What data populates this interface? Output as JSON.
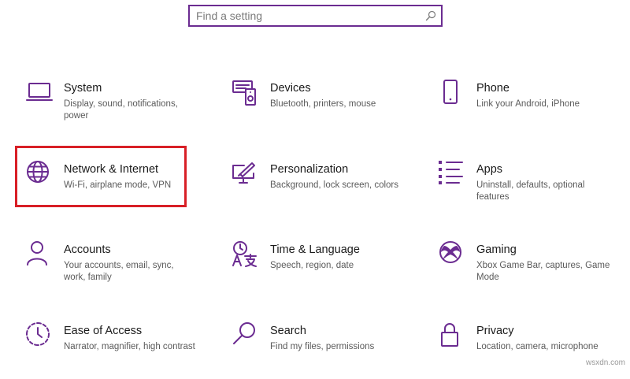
{
  "search": {
    "placeholder": "Find a setting",
    "value": ""
  },
  "colors": {
    "accent": "#6b2c91",
    "highlight": "#d81f26"
  },
  "tiles": [
    {
      "title": "System",
      "desc": "Display, sound, notifications, power",
      "icon": "laptop-icon"
    },
    {
      "title": "Devices",
      "desc": "Bluetooth, printers, mouse",
      "icon": "devices-icon"
    },
    {
      "title": "Phone",
      "desc": "Link your Android, iPhone",
      "icon": "phone-icon"
    },
    {
      "title": "Network & Internet",
      "desc": "Wi-Fi, airplane mode, VPN",
      "icon": "globe-icon"
    },
    {
      "title": "Personalization",
      "desc": "Background, lock screen, colors",
      "icon": "paint-monitor-icon"
    },
    {
      "title": "Apps",
      "desc": "Uninstall, defaults, optional features",
      "icon": "apps-list-icon"
    },
    {
      "title": "Accounts",
      "desc": "Your accounts, email, sync, work, family",
      "icon": "person-icon"
    },
    {
      "title": "Time & Language",
      "desc": "Speech, region, date",
      "icon": "time-language-icon"
    },
    {
      "title": "Gaming",
      "desc": "Xbox Game Bar, captures, Game Mode",
      "icon": "xbox-icon"
    },
    {
      "title": "Ease of Access",
      "desc": "Narrator, magnifier, high contrast",
      "icon": "ease-of-access-icon"
    },
    {
      "title": "Search",
      "desc": "Find my files, permissions",
      "icon": "search-icon"
    },
    {
      "title": "Privacy",
      "desc": "Location, camera, microphone",
      "icon": "lock-icon"
    }
  ],
  "watermark": "wsxdn.com"
}
